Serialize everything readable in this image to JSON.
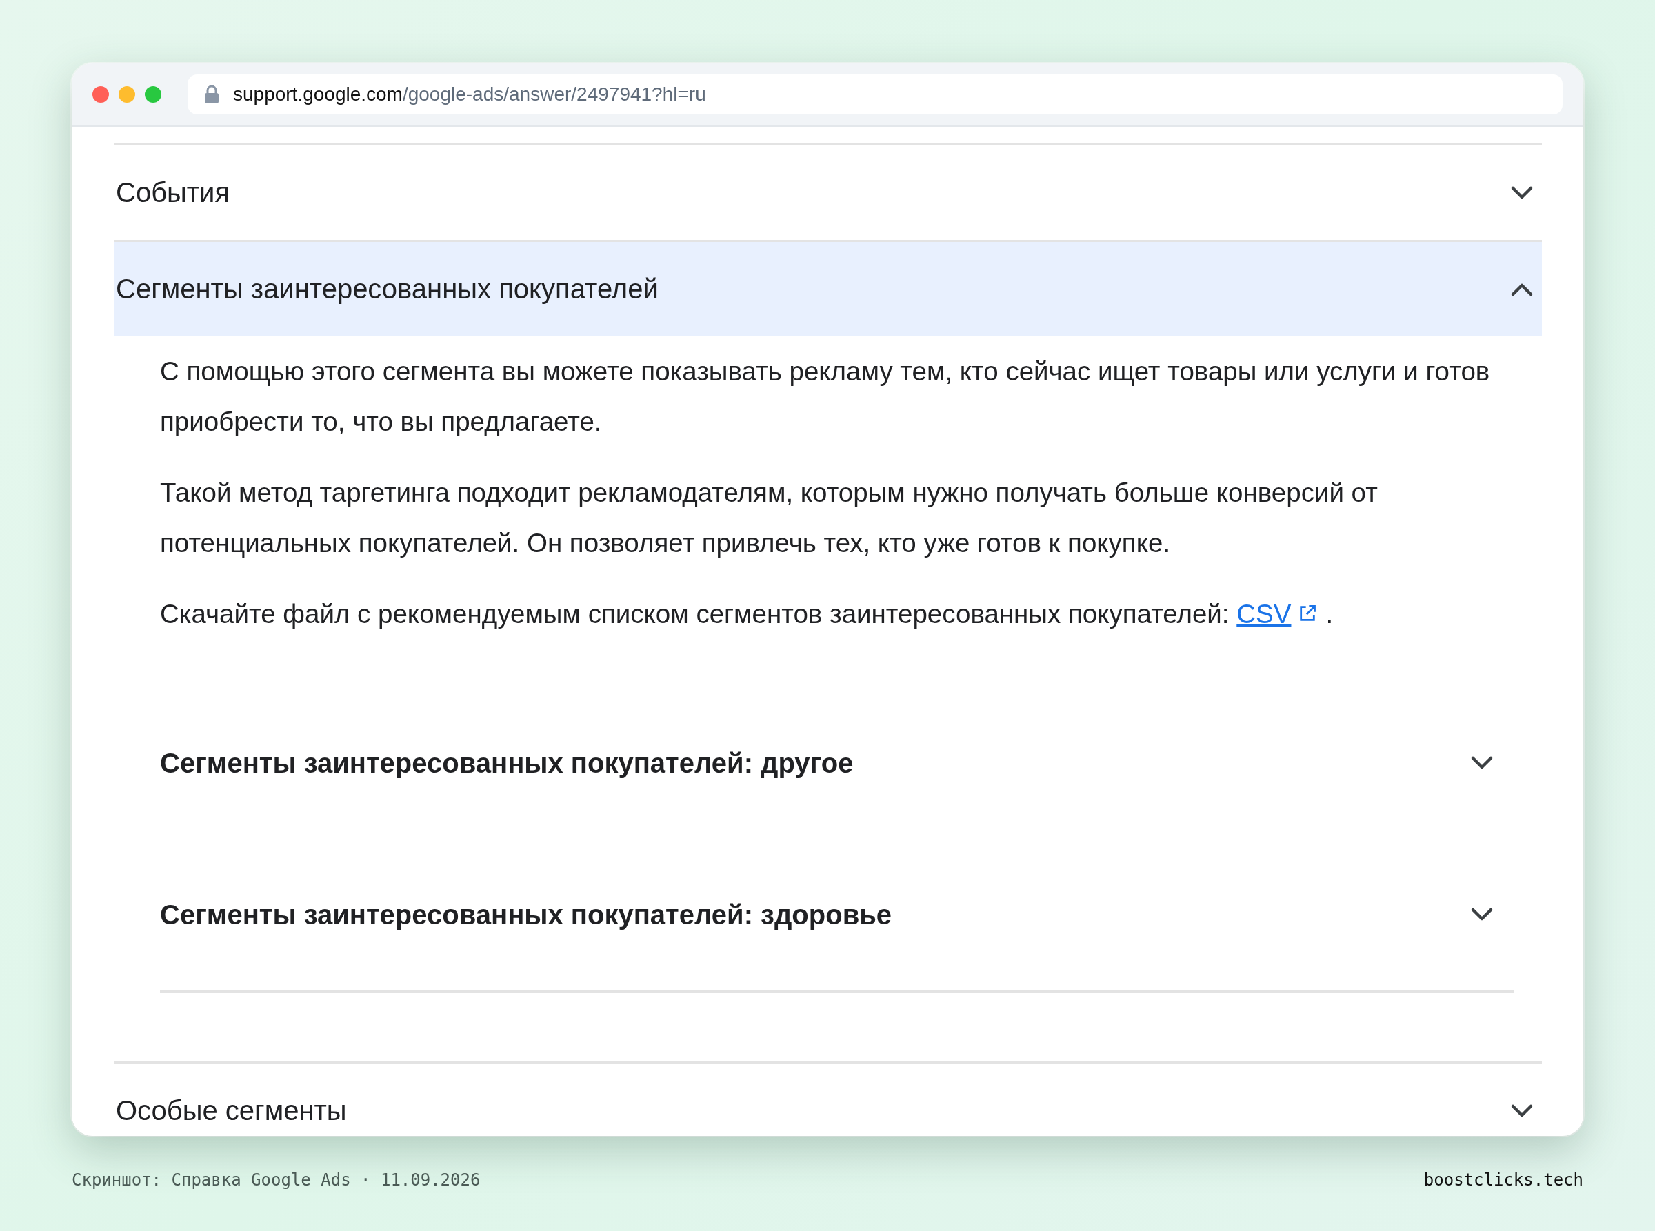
{
  "browser": {
    "url_host": "support.google.com",
    "url_path": "/google-ads/answer/2497941?hl=ru"
  },
  "accordion": [
    {
      "title": "События",
      "expanded": false
    },
    {
      "title": "Сегменты заинтересованных покупателей",
      "expanded": true,
      "paragraphs": [
        {
          "text": "С помощью этого сегмента вы можете показывать рекламу тем, кто сейчас ищет товары или услуги и готов приобрести то, что вы предлагаете."
        },
        {
          "text": "Такой метод таргетинга подходит рекламодателям, которым нужно получать больше конверсий от потенциальных покупателей. Он позволяет привлечь тех, кто уже готов к покупке."
        },
        {
          "text": "Скачайте файл с рекомендуемым списком сегментов заинтересованных покупателей:",
          "link": "CSV",
          "after": "."
        }
      ],
      "children": [
        {
          "title": "Сегменты заинтересованных покупателей: другое",
          "expanded": false
        },
        {
          "title": "Сегменты заинтересованных покупателей: здоровье",
          "expanded": false
        }
      ]
    },
    {
      "title": "Особые сегменты",
      "expanded": false
    }
  ],
  "footer": {
    "caption": "Скриншот: Справка Google Ads · 11.09.2026",
    "brand": "boostclicks.tech"
  }
}
